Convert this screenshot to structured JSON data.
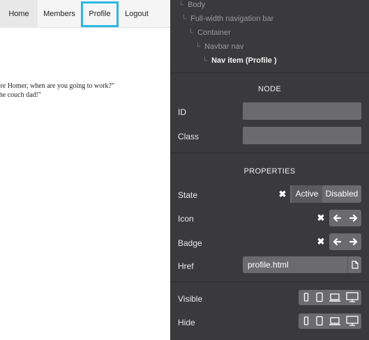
{
  "preview": {
    "nav": {
      "home": "Home",
      "members": "Members",
      "profile": "Profile",
      "logout": "Logout"
    },
    "quote_line1": "ere Homer, when are you going to work?\"",
    "quote_line2": " the couch dad!\""
  },
  "tree": {
    "body": "Body",
    "navbar": "Full-width navigation bar",
    "container": "Container",
    "navbar_nav": "Navbar nav",
    "nav_item": "Nav item (Profile )",
    "elbow": "└"
  },
  "node": {
    "title": "NODE",
    "id_label": "ID",
    "id_value": "",
    "class_label": "Class",
    "class_value": ""
  },
  "properties": {
    "title": "PROPERTIES",
    "state_label": "State",
    "state_clear": "✖",
    "state_active": "Active",
    "state_disabled": "Disabled",
    "icon_label": "Icon",
    "badge_label": "Badge",
    "clear_glyph": "✖",
    "arrow_left": "🡐",
    "arrow_right": "🡒",
    "href_label": "Href",
    "href_value": "profile.html",
    "visible_label": "Visible",
    "hide_label": "Hide",
    "device_icons": [
      "phone-icon",
      "tablet-icon",
      "laptop-icon",
      "desktop-icon"
    ]
  },
  "colors": {
    "panel_bg": "#3a3a3c",
    "field_bg": "#6b6b6d",
    "highlight": "#2bb7e3"
  }
}
